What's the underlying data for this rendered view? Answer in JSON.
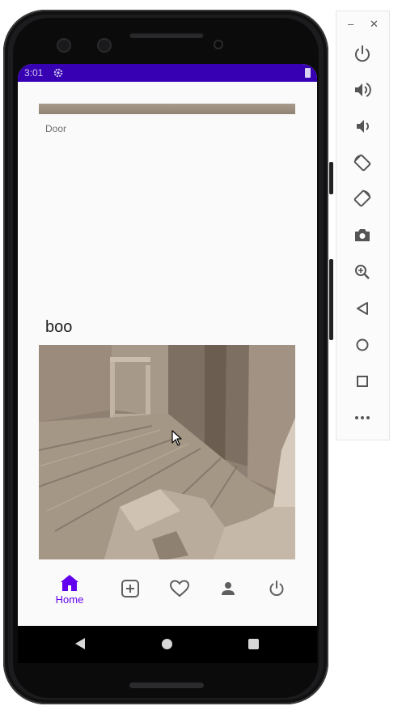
{
  "status_bar": {
    "time": "3:01"
  },
  "feed": {
    "previous_post_caption": "Door",
    "post_title": "boo"
  },
  "bottom_nav": {
    "home_label": "Home"
  },
  "toolbar": {
    "minimize": "–",
    "close": "✕"
  },
  "colors": {
    "status_bar": "#3700b3",
    "accent": "#6200ee",
    "screen_bg": "#fafafa"
  }
}
